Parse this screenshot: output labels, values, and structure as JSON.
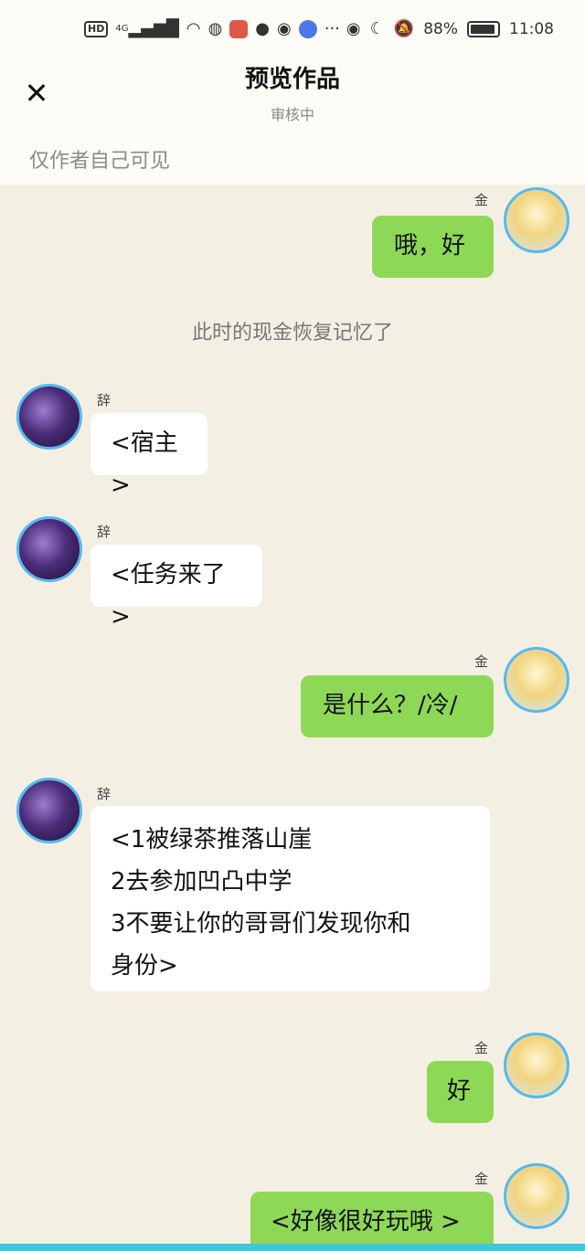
{
  "status_bar": {
    "hd": "HD",
    "net": "4G",
    "battery": "88%",
    "time": "11:08"
  },
  "header": {
    "close": "✕",
    "title": "预览作品",
    "subtitle": "审核中",
    "note": "仅作者自己可见"
  },
  "messages": [
    {
      "sender": "金",
      "side": "right",
      "text": "哦，好"
    },
    {
      "narration": "此时的现金恢复记忆了"
    },
    {
      "sender": "辞",
      "side": "left",
      "text": "<宿主>"
    },
    {
      "sender": "辞",
      "side": "left",
      "text": "<任务来了>"
    },
    {
      "sender": "金",
      "side": "right",
      "text": "是什么？/冷/"
    },
    {
      "sender": "辞",
      "side": "left",
      "lines": [
        "<1被绿茶推落山崖",
        "2去参加凹凸中学",
        "3不要让你的哥哥们发现你和",
        "身份>"
      ]
    },
    {
      "sender": "金",
      "side": "right",
      "text": "好"
    },
    {
      "sender": "金",
      "side": "right",
      "text": "<好像很好玩哦 >"
    }
  ]
}
